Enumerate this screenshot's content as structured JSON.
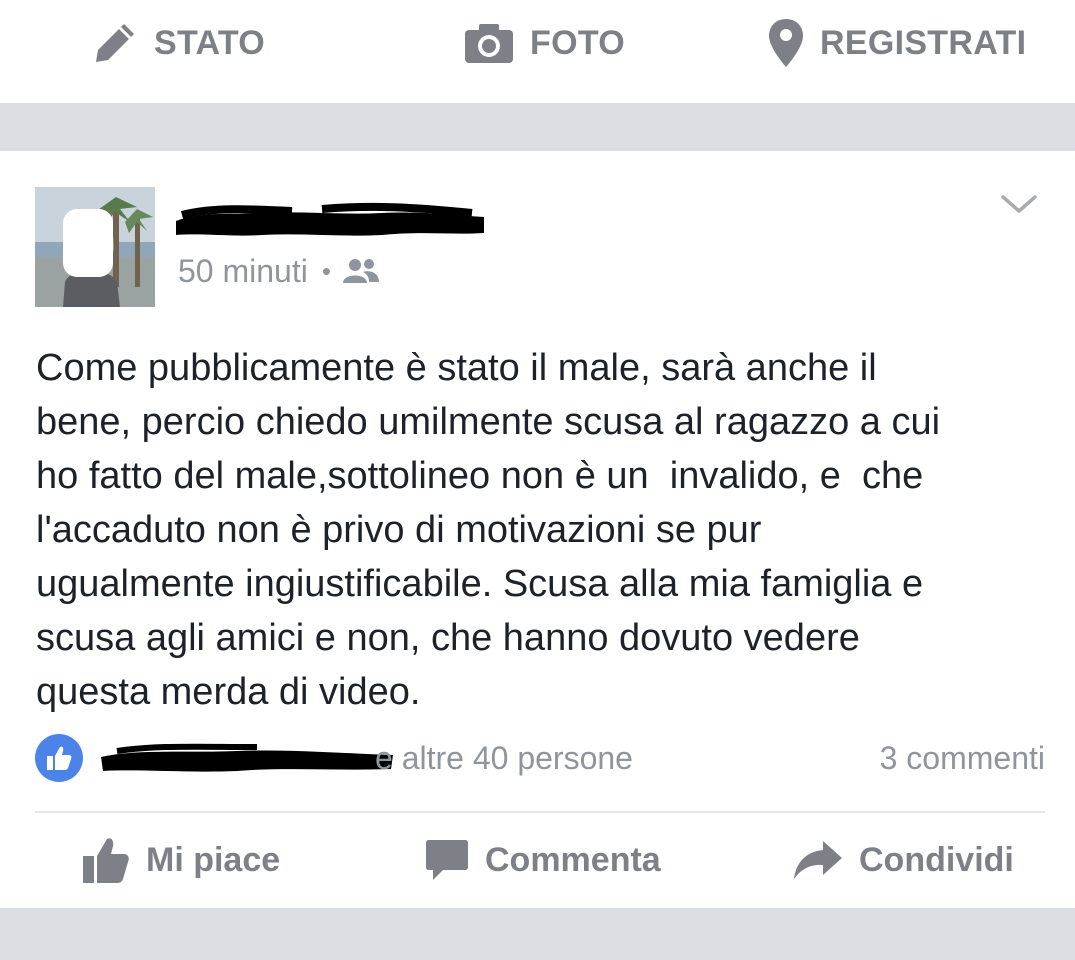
{
  "composer": {
    "status_label": "STATO",
    "photo_label": "FOTO",
    "checkin_label": "REGISTRATI"
  },
  "post": {
    "time": "50 minuti",
    "separator": "•",
    "privacy_icon": "friends-icon",
    "text": "Come pubblicamente è stato il male, sarà anche il\nbene, percio chiedo umilmente scusa al ragazzo a cui\nho fatto del male,sottolineo non è un  invalido, e  che\nl'accaduto non è privo di motivazioni se pur\nugualmente ingiustificabile. Scusa alla mia famiglia e\nscusa agli amici e non, che hanno dovuto vedere\nquesta merda di video.",
    "others_text": "e altre 40 persone",
    "comments_text": "3 commenti"
  },
  "actions": {
    "like_label": "Mi piace",
    "comment_label": "Commenta",
    "share_label": "Condividi"
  },
  "colors": {
    "accent_blue": "#4b83e8",
    "muted_text": "#90949c",
    "action_text": "#7d8087",
    "body_text": "#1d2129",
    "background": "#dcdee3"
  }
}
